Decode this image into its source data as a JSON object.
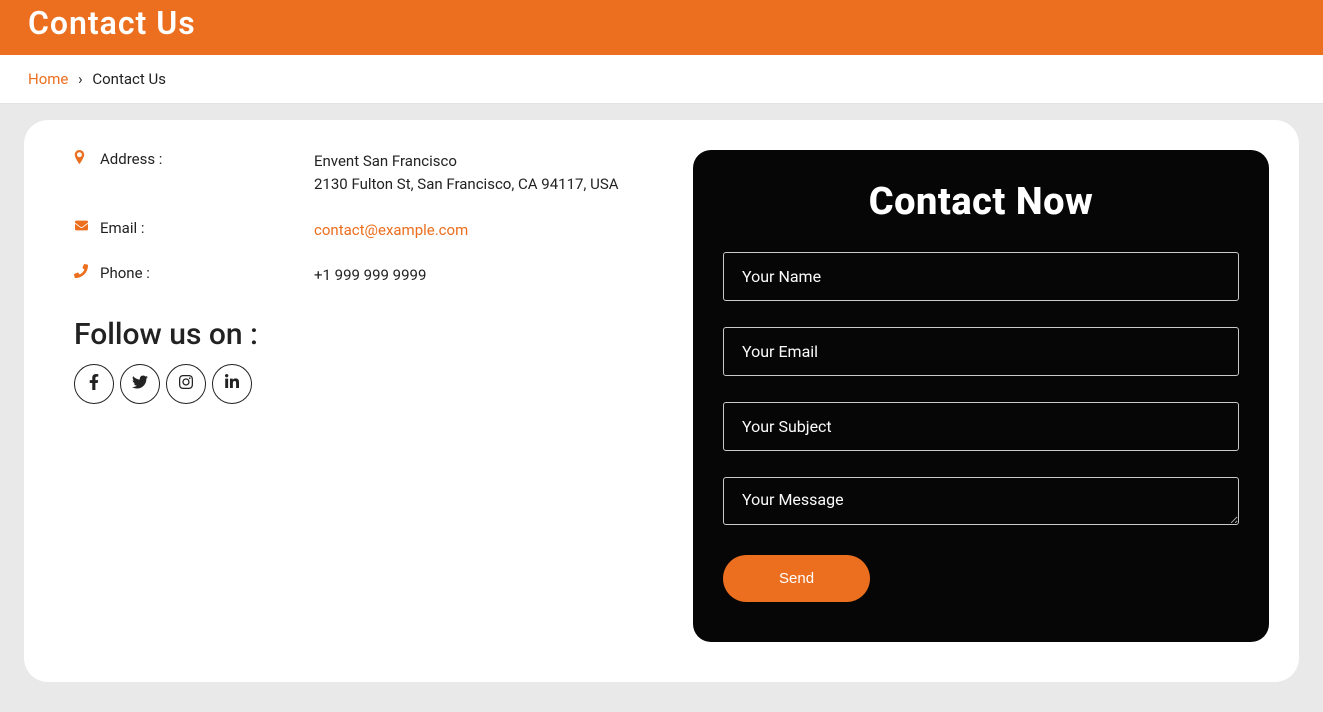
{
  "header": {
    "title": "Contact Us"
  },
  "breadcrumb": {
    "home": "Home",
    "current": "Contact Us"
  },
  "info": {
    "address_label": "Address :",
    "address_value_line1": "Envent San Francisco",
    "address_value_line2": "2130 Fulton St, San Francisco, CA 94117, USA",
    "email_label": "Email :",
    "email_value": "contact@example.com",
    "phone_label": "Phone :",
    "phone_value": "+1 999 999 9999"
  },
  "follow": {
    "heading": "Follow us on :",
    "socials": [
      "facebook",
      "twitter",
      "instagram",
      "linkedin"
    ]
  },
  "form": {
    "title": "Contact Now",
    "name_placeholder": "Your Name",
    "email_placeholder": "Your Email",
    "subject_placeholder": "Your Subject",
    "message_placeholder": "Your Message",
    "send_label": "Send"
  }
}
